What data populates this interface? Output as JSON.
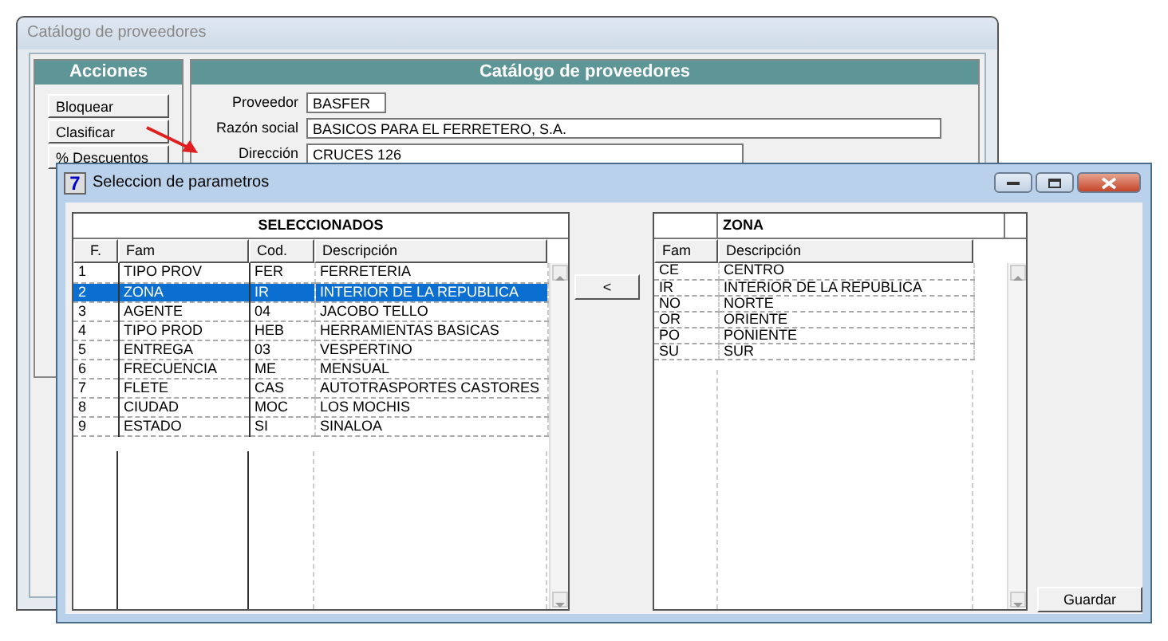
{
  "back_window": {
    "title": "Catálogo de proveedores",
    "actions_panel": {
      "title": "Acciones",
      "buttons": [
        "Bloquear",
        "Clasificar",
        "% Descuentos"
      ]
    },
    "catalog_panel": {
      "title": "Catálogo de proveedores",
      "fields": [
        {
          "label": "Proveedor",
          "value": "BASFER"
        },
        {
          "label": "Razón social",
          "value": "BASICOS PARA EL FERRETERO, S.A."
        },
        {
          "label": "Dirección",
          "value": "CRUCES 126"
        }
      ]
    }
  },
  "dialog": {
    "title": "Seleccion de parametros",
    "icon_text": "7",
    "selected_grid": {
      "title": "SELECCIONADOS",
      "columns": [
        "F.",
        "Fam",
        "Cod.",
        "Descripción"
      ],
      "rows": [
        {
          "cells": [
            "1",
            "TIPO PROV",
            "FER",
            "FERRETERIA"
          ],
          "selected": false
        },
        {
          "cells": [
            "2",
            "ZONA",
            "IR",
            "INTERIOR DE LA REPUBLICA"
          ],
          "selected": true
        },
        {
          "cells": [
            "3",
            "AGENTE",
            "04",
            "JACOBO TELLO"
          ],
          "selected": false
        },
        {
          "cells": [
            "4",
            "TIPO PROD",
            "HEB",
            "HERRAMIENTAS BASICAS"
          ],
          "selected": false
        },
        {
          "cells": [
            "5",
            "ENTREGA",
            "03",
            "VESPERTINO"
          ],
          "selected": false
        },
        {
          "cells": [
            "6",
            "FRECUENCIA",
            "ME",
            "MENSUAL"
          ],
          "selected": false
        },
        {
          "cells": [
            "7",
            "FLETE",
            "CAS",
            "AUTOTRASPORTES CASTORES"
          ],
          "selected": false
        },
        {
          "cells": [
            "8",
            "CIUDAD",
            "MOC",
            "LOS MOCHIS"
          ],
          "selected": false
        },
        {
          "cells": [
            "9",
            "ESTADO",
            "SI",
            "SINALOA"
          ],
          "selected": false
        }
      ]
    },
    "move_button": "<",
    "options_grid": {
      "title": "ZONA",
      "columns": [
        "Fam",
        "Descripción"
      ],
      "rows": [
        {
          "cells": [
            "CE",
            "CENTRO"
          ]
        },
        {
          "cells": [
            "IR",
            "INTERIOR DE LA REPUBLICA"
          ]
        },
        {
          "cells": [
            "NO",
            "NORTE"
          ]
        },
        {
          "cells": [
            "OR",
            "ORIENTE"
          ]
        },
        {
          "cells": [
            "PO",
            "PONIENTE"
          ]
        },
        {
          "cells": [
            "SU",
            "SUR"
          ]
        }
      ]
    },
    "save_button": "Guardar"
  }
}
